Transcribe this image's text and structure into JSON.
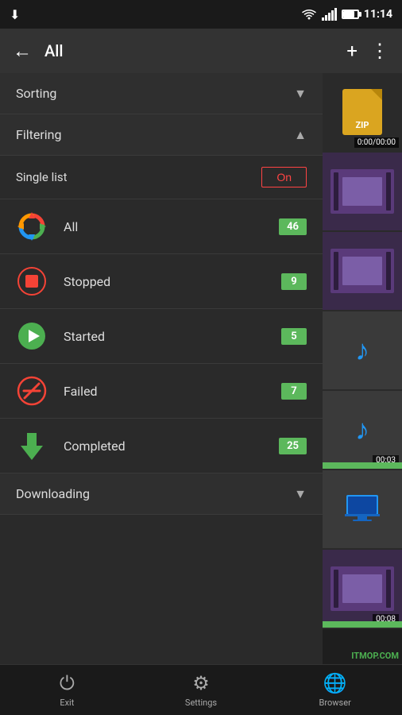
{
  "statusBar": {
    "time": "11:14",
    "downloadIcon": "↓",
    "wifiIcon": "📶",
    "batteryLevel": 80
  },
  "appBar": {
    "backIcon": "←",
    "title": "All",
    "addIcon": "+",
    "moreIcon": "⋮"
  },
  "sorting": {
    "label": "Sorting",
    "chevron": "▼"
  },
  "filtering": {
    "label": "Filtering",
    "chevron": "▲"
  },
  "singleList": {
    "label": "Single list",
    "value": "On"
  },
  "filterItems": [
    {
      "id": "all",
      "label": "All",
      "count": 46,
      "iconType": "all"
    },
    {
      "id": "stopped",
      "label": "Stopped",
      "count": 9,
      "iconType": "stopped"
    },
    {
      "id": "started",
      "label": "Started",
      "count": 5,
      "iconType": "started"
    },
    {
      "id": "failed",
      "label": "Failed",
      "count": 7,
      "iconType": "failed"
    },
    {
      "id": "completed",
      "label": "Completed",
      "count": 25,
      "iconType": "completed"
    }
  ],
  "downloading": {
    "label": "Downloading",
    "chevron": "▼"
  },
  "bottomNav": [
    {
      "id": "exit",
      "icon": "⏻",
      "label": "Exit"
    },
    {
      "id": "settings",
      "icon": "⚙",
      "label": "Settings"
    },
    {
      "id": "browser",
      "icon": "🌐",
      "label": "Browser"
    }
  ],
  "rightPanel": {
    "items": [
      {
        "type": "zip",
        "overlay": "0:00/00:00"
      },
      {
        "type": "film",
        "color": "#7B5EA7"
      },
      {
        "type": "film",
        "color": "#7B5EA7"
      },
      {
        "type": "music",
        "hasGreenBar": false
      },
      {
        "type": "music",
        "overlay": "00:03",
        "hasGreenBar": true
      },
      {
        "type": "monitor",
        "hasGreenBar": false
      },
      {
        "type": "film",
        "color": "#7B5EA7",
        "overlay": "00:08",
        "hasGreenBar": true
      }
    ]
  },
  "watermark": "ITMOP.COM"
}
